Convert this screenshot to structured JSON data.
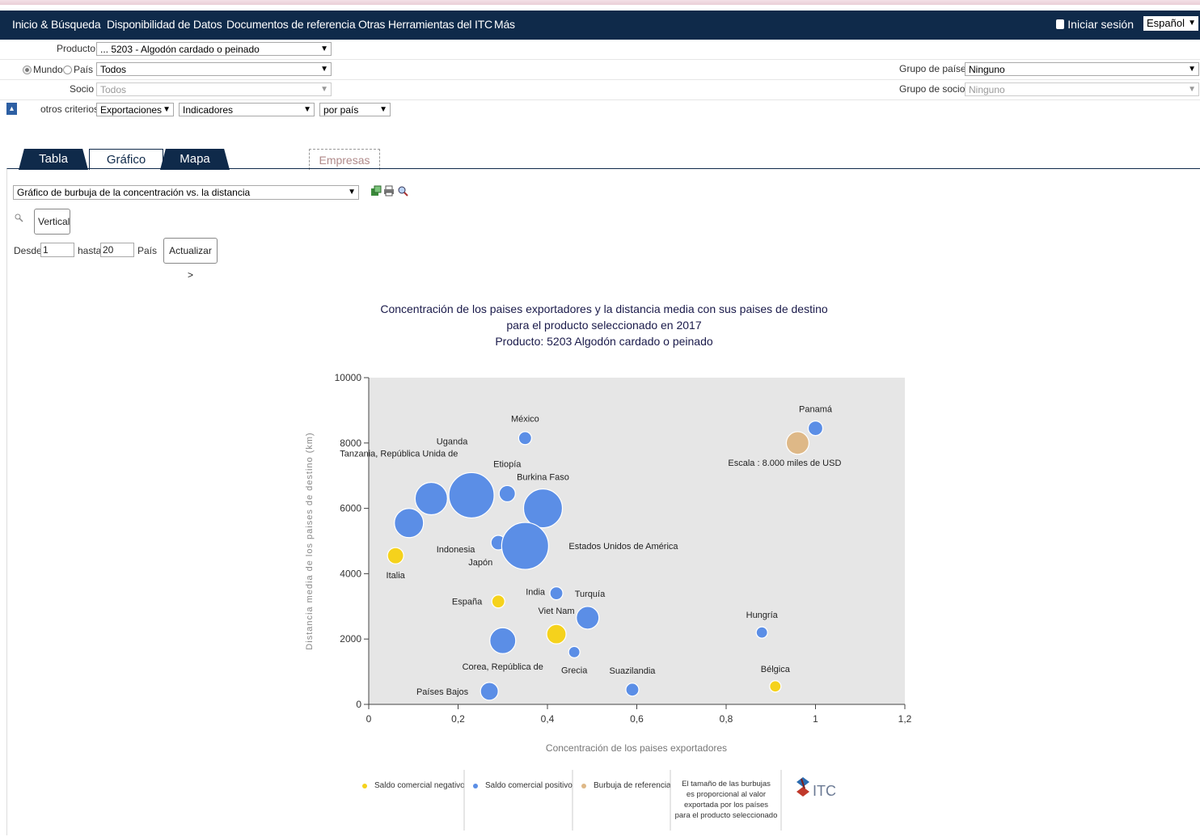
{
  "nav": {
    "items": [
      "Inicio & Búsqueda",
      "Disponibilidad de Datos",
      "Documentos de referencia",
      "Otras Herramientas del ITC",
      "Más"
    ],
    "login": "Iniciar sesión",
    "language": "Español"
  },
  "filters": {
    "producto_label": "Producto",
    "producto_value": "... 5203 - Algodón cardado o peinado",
    "mundo_label": "Mundo",
    "pais_label": "País",
    "pais_value": "Todos",
    "socio_label": "Socio",
    "socio_value": "Todos",
    "otros_label": "otros criterios",
    "flujo_value": "Exportaciones",
    "indicadores_value": "Indicadores",
    "por_value": "por país",
    "grupo_paises_label": "Grupo de países",
    "grupo_paises_value": "Ninguno",
    "grupo_socios_label": "Grupo de socios",
    "grupo_socios_value": "Ninguno"
  },
  "tabs": [
    "Tabla",
    "Gráfico",
    "Mapa",
    "Empresas"
  ],
  "controls": {
    "chart_select": "Gráfico de burbuja de la concentración vs. la distancia",
    "vertical_button": "Vertical",
    "desde_label": "Desde",
    "desde_value": "1",
    "hasta_label": "hasta",
    "hasta_value": "20",
    "pais_label": "País",
    "actualizar_button": "Actualizar >"
  },
  "colors": {
    "navy": "#0f2a4a",
    "positive": "#5b8ee6",
    "negative": "#f5d21c",
    "reference": "#deb887"
  },
  "chart_data": {
    "type": "scatter",
    "title": [
      "Concentración de los paises exportadores y la distancia media con sus paises de destino",
      "para el producto seleccionado en 2017",
      "Producto: 5203 Algodón cardado o peinado"
    ],
    "xlabel": "Concentración de los paises exportadores",
    "ylabel": "Distancia media de los paises de destino (km)",
    "xlim": [
      0,
      1.2
    ],
    "ylim": [
      0,
      10000
    ],
    "xticks": [
      "0",
      "0,2",
      "0,4",
      "0,6",
      "0,8",
      "1",
      "1,2"
    ],
    "yticks": [
      "0",
      "2000",
      "4000",
      "6000",
      "8000",
      "10000"
    ],
    "grid": false,
    "points": [
      {
        "label": "Panamá",
        "x": 1.0,
        "y": 8450,
        "r": 9,
        "kind": "pos"
      },
      {
        "label": "Escala : 8.000 miles de USD",
        "x": 0.96,
        "y": 8000,
        "r": 14,
        "kind": "ref"
      },
      {
        "label": "México",
        "x": 0.35,
        "y": 8150,
        "r": 8,
        "kind": "pos"
      },
      {
        "label": "Tanzania, República Unida de",
        "x": 0.14,
        "y": 6300,
        "r": 20,
        "kind": "pos"
      },
      {
        "label": "Uganda",
        "x": 0.23,
        "y": 6400,
        "r": 28,
        "kind": "pos"
      },
      {
        "label": "Etiopía",
        "x": 0.31,
        "y": 6450,
        "r": 10,
        "kind": "pos"
      },
      {
        "label": "Burkina Faso",
        "x": 0.39,
        "y": 6000,
        "r": 24,
        "kind": "pos"
      },
      {
        "label": "Indonesia",
        "x": 0.09,
        "y": 5550,
        "r": 18,
        "kind": "pos"
      },
      {
        "label": "Japón",
        "x": 0.29,
        "y": 4950,
        "r": 9,
        "kind": "pos"
      },
      {
        "label": "Estados Unidos de América",
        "x": 0.35,
        "y": 4850,
        "r": 29,
        "kind": "pos"
      },
      {
        "label": "Italia",
        "x": 0.06,
        "y": 4550,
        "r": 10,
        "kind": "neg"
      },
      {
        "label": "India",
        "x": 0.42,
        "y": 3400,
        "r": 8,
        "kind": "pos"
      },
      {
        "label": "Turquía",
        "x": 0.49,
        "y": 2650,
        "r": 14,
        "kind": "pos"
      },
      {
        "label": "España",
        "x": 0.29,
        "y": 3150,
        "r": 8,
        "kind": "neg"
      },
      {
        "label": "Viet Nam",
        "x": 0.42,
        "y": 2150,
        "r": 12,
        "kind": "neg"
      },
      {
        "label": "Hungría",
        "x": 0.88,
        "y": 2200,
        "r": 7,
        "kind": "pos"
      },
      {
        "label": "Corea, República de",
        "x": 0.3,
        "y": 1950,
        "r": 16,
        "kind": "pos"
      },
      {
        "label": "Grecia",
        "x": 0.46,
        "y": 1600,
        "r": 7,
        "kind": "pos"
      },
      {
        "label": "Suazilandia",
        "x": 0.59,
        "y": 450,
        "r": 8,
        "kind": "pos"
      },
      {
        "label": "Bélgica",
        "x": 0.91,
        "y": 550,
        "r": 7,
        "kind": "neg"
      },
      {
        "label": "Países Bajos",
        "x": 0.27,
        "y": 400,
        "r": 11,
        "kind": "pos"
      }
    ],
    "legend": {
      "negative": "Saldo comercial negativo",
      "positive": "Saldo comercial positivo",
      "reference": "Burbuja de referencia",
      "note": [
        "El tamaño de las burbujas",
        "es proporcional al valor",
        "exportada por los países",
        "para el producto seleccionado"
      ],
      "logo": "ITC"
    }
  }
}
